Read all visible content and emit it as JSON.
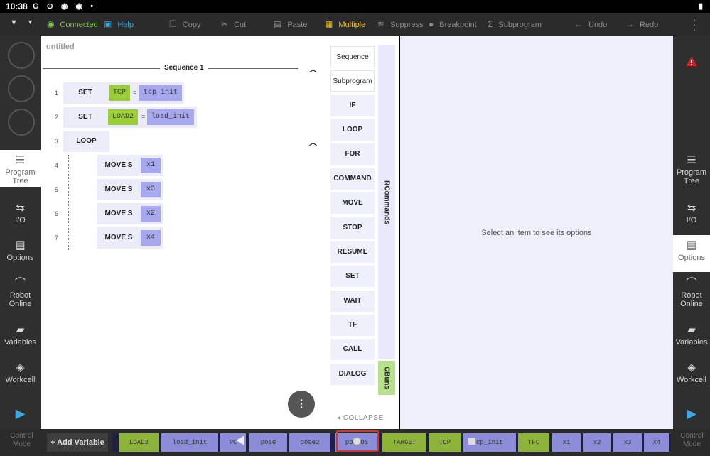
{
  "status_bar": {
    "time": "10:38",
    "icons": "G ⊙ ◉ ◉ •"
  },
  "toolbar": {
    "connected": "Connected",
    "help": "Help",
    "copy": "Copy",
    "cut": "Cut",
    "paste": "Paste",
    "multiple": "Multiple",
    "suppress": "Suppress",
    "breakpoint": "Breakpoint",
    "subprogram": "Subprogram",
    "undo": "Undo",
    "redo": "Redo"
  },
  "left_nav": [
    {
      "label1": "Program",
      "label2": "Tree",
      "active": true
    },
    {
      "label1": "I/O",
      "label2": ""
    },
    {
      "label1": "Options",
      "label2": ""
    },
    {
      "label1": "Robot",
      "label2": "Online"
    },
    {
      "label1": "Variables",
      "label2": ""
    },
    {
      "label1": "Workcell",
      "label2": ""
    }
  ],
  "right_nav": [
    {
      "label1": "Program",
      "label2": "Tree"
    },
    {
      "label1": "I/O",
      "label2": ""
    },
    {
      "label1": "Options",
      "label2": "",
      "active": true
    },
    {
      "label1": "Robot",
      "label2": "Online"
    },
    {
      "label1": "Variables",
      "label2": ""
    },
    {
      "label1": "Workcell",
      "label2": ""
    }
  ],
  "program": {
    "title": "untitled",
    "sequence_label": "Sequence 1",
    "lines": [
      {
        "num": "1",
        "cmd": "SET",
        "var": "TCP",
        "eq": "=",
        "val": "tcp_init"
      },
      {
        "num": "2",
        "cmd": "SET",
        "var": "LOAD2",
        "eq": "=",
        "val": "load_init"
      },
      {
        "num": "3",
        "cmd": "LOOP"
      },
      {
        "num": "4",
        "cmd": "MOVE S",
        "arg": "x1"
      },
      {
        "num": "5",
        "cmd": "MOVE S",
        "arg": "x3"
      },
      {
        "num": "6",
        "cmd": "MOVE S",
        "arg": "x2"
      },
      {
        "num": "7",
        "cmd": "MOVE S",
        "arg": "x4"
      }
    ]
  },
  "palette": {
    "buttons": [
      "Sequence",
      "Subprogram",
      "IF",
      "LOOP",
      "FOR",
      "COMMAND",
      "MOVE",
      "STOP",
      "RESUME",
      "SET",
      "WAIT",
      "TF",
      "CALL",
      "DIALOG"
    ],
    "rcommands": "RCommands",
    "cbuns": "CBuns",
    "collapse": "COLLAPSE"
  },
  "options_panel": {
    "hint": "Select an item to see its options"
  },
  "bottom": {
    "control_mode_1": "Control",
    "control_mode_2": "Mode",
    "add_variable": "+ Add Variable",
    "variables": [
      {
        "name": "LOAD2",
        "kind": "green"
      },
      {
        "name": "load_init",
        "kind": "purple"
      },
      {
        "name": "PC",
        "kind": "purple"
      },
      {
        "name": "pose",
        "kind": "purple"
      },
      {
        "name": "pose2",
        "kind": "purple"
      },
      {
        "name": "pos  OS",
        "kind": "purple"
      },
      {
        "name": "TARGET",
        "kind": "green"
      },
      {
        "name": "TCP",
        "kind": "green"
      },
      {
        "name": "cp_init",
        "kind": "purple"
      },
      {
        "name": "TFC",
        "kind": "green"
      },
      {
        "name": "x1",
        "kind": "purple"
      },
      {
        "name": "x2",
        "kind": "purple"
      },
      {
        "name": "x3",
        "kind": "purple"
      },
      {
        "name": "x4",
        "kind": "purple"
      }
    ]
  }
}
